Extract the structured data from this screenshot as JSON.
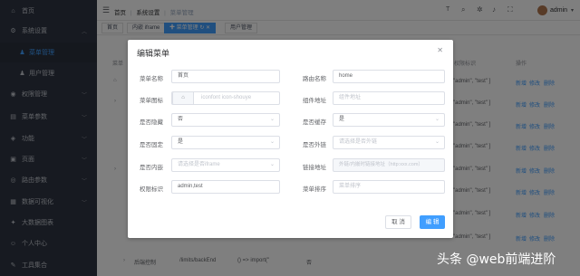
{
  "sidebar": {
    "items": [
      {
        "label": "首页",
        "icon": "home-icon"
      },
      {
        "label": "系统设置",
        "icon": "gear-icon",
        "expanded": true
      },
      {
        "label": "菜单管理",
        "icon": "user-icon"
      },
      {
        "label": "用户管理",
        "icon": "user-icon"
      },
      {
        "label": "权限管理",
        "icon": "lock-icon"
      },
      {
        "label": "菜单参数",
        "icon": "menu-icon"
      },
      {
        "label": "功能",
        "icon": "function-icon"
      },
      {
        "label": "页面",
        "icon": "page-icon"
      },
      {
        "label": "路由参数",
        "icon": "route-icon"
      },
      {
        "label": "数据可视化",
        "icon": "chart-icon"
      },
      {
        "label": "大数据图表",
        "icon": "bigdata-icon"
      },
      {
        "label": "个人中心",
        "icon": "person-icon"
      },
      {
        "label": "工具集合",
        "icon": "tools-icon"
      }
    ]
  },
  "header": {
    "breadcrumb": [
      "首页",
      "系统设置",
      "菜单管理"
    ],
    "username": "admin"
  },
  "tags": [
    "首页",
    "内嵌 iframe",
    "菜单管理",
    "用户管理"
  ],
  "table": {
    "col_menu": "菜单",
    "col_perm": "权限标识",
    "col_ops": "操作",
    "perm_values": [
      "\"admin\", \"test\" ]",
      "\"admin\", \"test\" ]",
      "\"admin\", \"test\" ]",
      "\"admin\", \"test\" ]",
      "\"admin\", \"test\" ]",
      "\"admin\", \"test\" ]",
      "\"admin\", \"test\" ]",
      "\"admin\", \"test\" ]"
    ],
    "op_add": "新增",
    "op_edit": "修改",
    "op_delete": "删除",
    "bottom_rows": [
      {
        "name": "后端控制",
        "path": "/limits/backEnd",
        "component": "() => import(\"",
        "no": "否"
      }
    ]
  },
  "dialog": {
    "title": "编辑菜单",
    "fields": {
      "menu_name_label": "菜单名称",
      "menu_name_value": "首页",
      "route_name_label": "路由名称",
      "route_name_value": "home",
      "menu_icon_label": "菜单图标",
      "menu_icon_placeholder": "iconfont icon-shouye",
      "component_addr_label": "组件地址",
      "component_addr_placeholder": "组件地址",
      "hidden_label": "是否隐藏",
      "hidden_value": "否",
      "cache_label": "是否缓存",
      "cache_value": "是",
      "fixed_label": "是否固定",
      "fixed_value": "是",
      "external_label": "是否外链",
      "external_placeholder": "请选择是否外链",
      "iframe_label": "是否内嵌",
      "iframe_placeholder": "请选择是否iframe",
      "link_label": "链接地址",
      "link_placeholder": "外链/内嵌时链接地址（http:xxx.com）",
      "perm_label": "权限标识",
      "perm_value": "admin,test",
      "sort_label": "菜单排序",
      "sort_placeholder": "菜单排序"
    },
    "cancel_label": "取 消",
    "confirm_label": "编 辑"
  },
  "watermark": "头条 @web前端进阶",
  "colors": {
    "primary": "#409eff",
    "sidebar": "#2e3542",
    "overlay": "rgba(0,0,0,0.5)"
  }
}
